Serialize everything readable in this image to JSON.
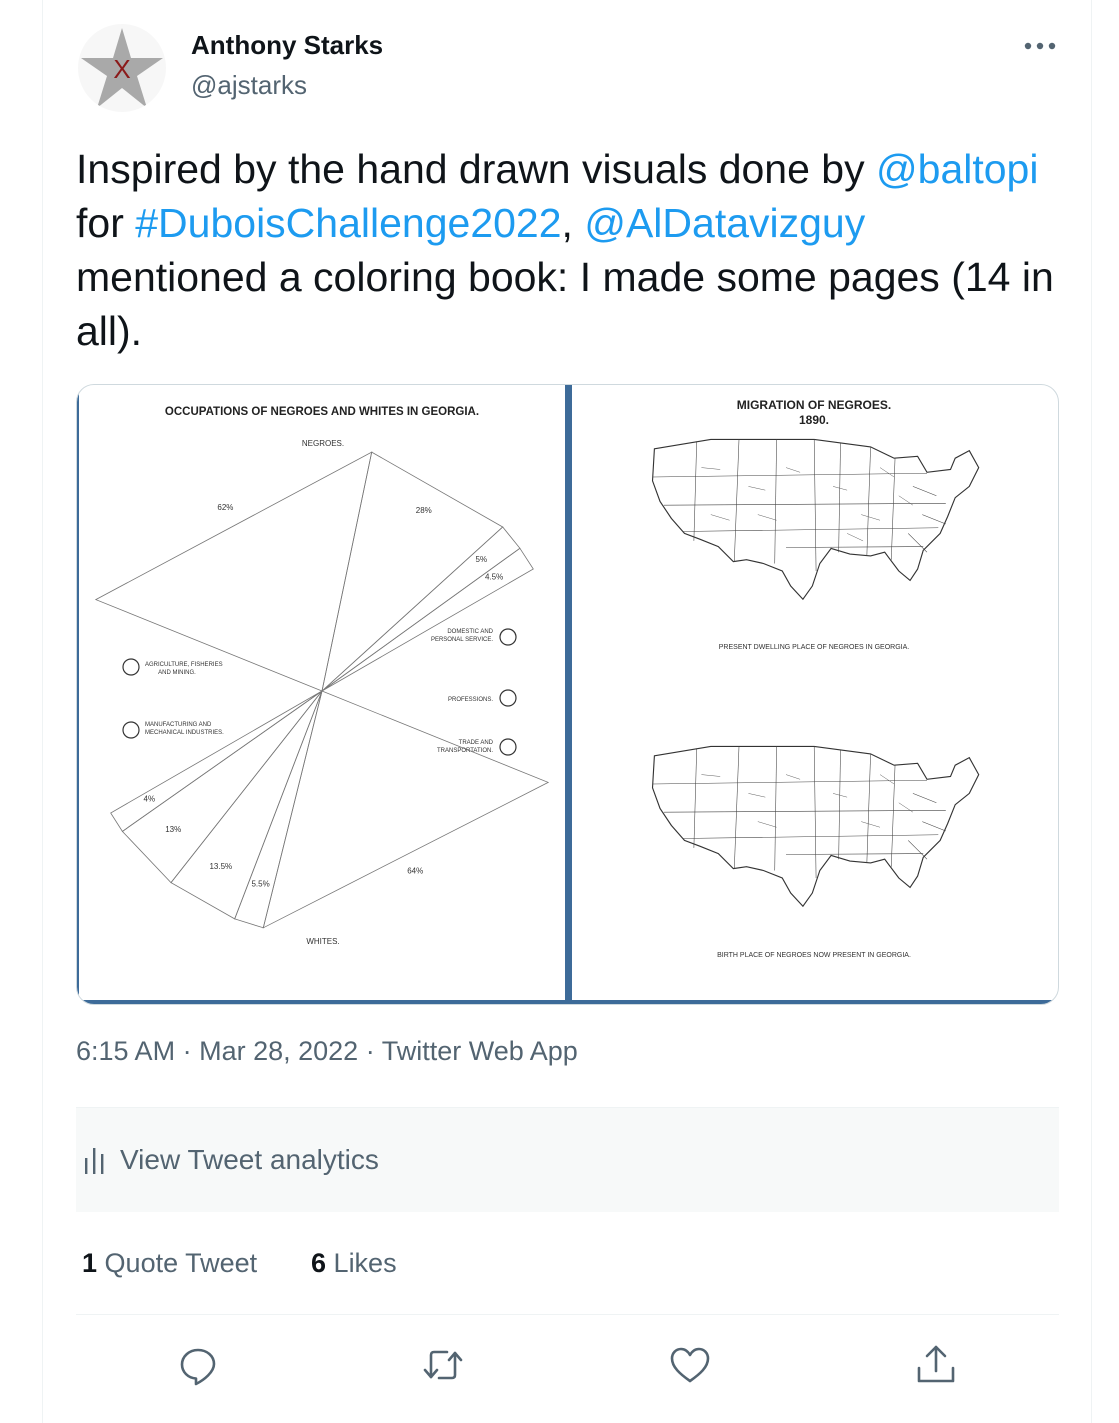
{
  "author": {
    "name": "Anthony Starks",
    "handle": "@ajstarks",
    "avatar_mark": "X",
    "more_icon": "more-icon"
  },
  "tweet": {
    "segments": [
      {
        "text": "Inspired by the hand drawn visuals done by ",
        "link": false
      },
      {
        "text": "@baltopi",
        "link": true
      },
      {
        "text": " for ",
        "link": false
      },
      {
        "text": "#DuboisChallenge2022",
        "link": true
      },
      {
        "text": ", ",
        "link": false
      },
      {
        "text": "@AlDatavizguy",
        "link": true
      },
      {
        "text": " mentioned a coloring book: I made some pages (14 in all).",
        "link": false
      }
    ]
  },
  "media": {
    "left_page": {
      "title": "OCCUPATIONS OF NEGROES AND WHITES IN GEORGIA.",
      "top_label": "NEGROES.",
      "bottom_label": "WHITES.",
      "legend": [
        {
          "lines": [
            "AGRICULTURE, FISHERIES",
            "AND MINING."
          ]
        },
        {
          "lines": [
            "MANUFACTURING AND",
            "MECHANICAL INDUSTRIES."
          ]
        },
        {
          "lines": [
            "DOMESTIC AND",
            "PERSONAL SERVICE."
          ]
        },
        {
          "lines": [
            "PROFESSIONS."
          ]
        },
        {
          "lines": [
            "TRADE AND",
            "TRANSPORTATION."
          ]
        }
      ]
    },
    "right_page": {
      "title_line1": "MIGRATION OF NEGROES.",
      "title_line2": "1890.",
      "caption_top": "PRESENT DWELLING PLACE OF NEGROES IN GEORGIA.",
      "caption_bottom": "BIRTH PLACE OF NEGROES NOW PRESENT IN GEORGIA."
    }
  },
  "chart_data": {
    "type": "pie",
    "title": "OCCUPATIONS OF NEGROES AND WHITES IN GEORGIA.",
    "series": [
      {
        "name": "NEGROES.",
        "labels": [
          "62%",
          "28%",
          "5%",
          "4.5%"
        ],
        "values": [
          62,
          28,
          5,
          4.5
        ]
      },
      {
        "name": "WHITES.",
        "labels": [
          "64%",
          "5.5%",
          "13.5%",
          "13%",
          "4%"
        ],
        "values": [
          64,
          5.5,
          13.5,
          13,
          4
        ]
      }
    ]
  },
  "meta": {
    "time": "6:15 AM",
    "sep1": "·",
    "date": "Mar 28, 2022",
    "sep2": "·",
    "source": "Twitter Web App"
  },
  "analytics": {
    "label": "View Tweet analytics"
  },
  "stats": {
    "quote_count": "1",
    "quote_label": "Quote Tweet",
    "like_count": "6",
    "like_label": "Likes"
  },
  "actions": [
    "reply-icon",
    "retweet-icon",
    "like-icon",
    "share-icon"
  ]
}
